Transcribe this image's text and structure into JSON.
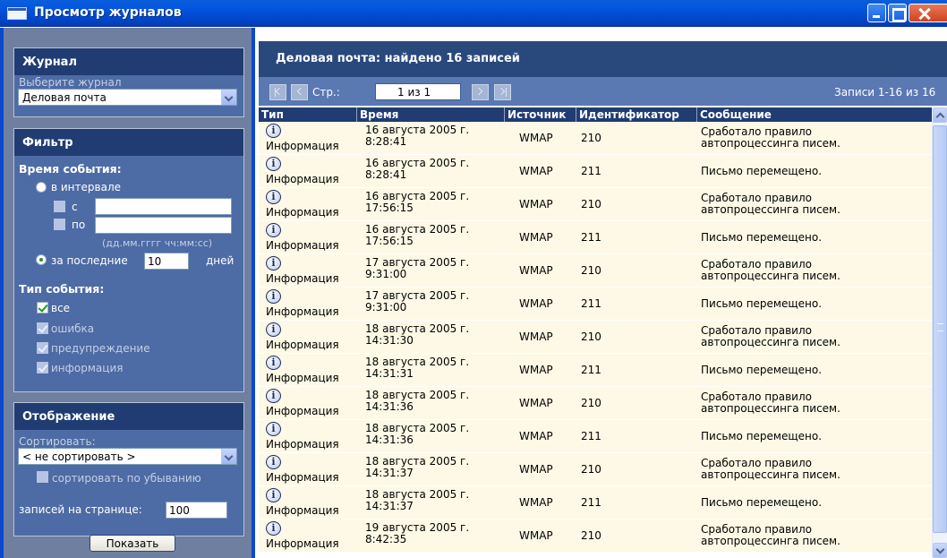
{
  "window": {
    "title": "Просмотр журналов"
  },
  "sidebar": {
    "journal": {
      "heading": "Журнал",
      "select_label": "Выберите журнал",
      "selected": "Деловая почта"
    },
    "filter": {
      "heading": "Фильтр",
      "event_time_label": "Время события:",
      "in_interval_label": "в интервале",
      "from_label": "с",
      "from_value": "",
      "to_label": "по",
      "to_value": "",
      "format_hint": "(дд.мм.гггг чч:мм:сс)",
      "last_label": "за последние",
      "last_value": "10",
      "days_label": "дней",
      "time_mode": "last",
      "event_type_label": "Тип события:",
      "types": [
        {
          "label": "все",
          "checked": true,
          "enabled": true
        },
        {
          "label": "ошибка",
          "checked": true,
          "enabled": false
        },
        {
          "label": "предупреждение",
          "checked": true,
          "enabled": false
        },
        {
          "label": "информация",
          "checked": true,
          "enabled": false
        }
      ]
    },
    "display": {
      "heading": "Отображение",
      "sort_label": "Сортировать:",
      "sort_value": "< не сортировать >",
      "desc_label": "сортировать по убыванию",
      "desc_checked": false,
      "per_page_label": "записей на странице:",
      "per_page_value": "100"
    },
    "show_button": "Показать"
  },
  "main": {
    "heading": "Деловая почта: найдено 16 записей",
    "pager": {
      "page_label": "Стр.:",
      "page_value": "1 из 1",
      "records_info": "Записи 1-16 из 16"
    },
    "columns": [
      "Тип",
      "Время",
      "Источник",
      "Идентификатор",
      "Сообщение"
    ],
    "rows": [
      {
        "type": "Информация",
        "time1": "16 августа 2005 г.",
        "time2": "8:28:41",
        "source": "WMAP",
        "id": "210",
        "msg1": "Сработало правило",
        "msg2": "автопроцессинга писем."
      },
      {
        "type": "Информация",
        "time1": "16 августа 2005 г.",
        "time2": "8:28:41",
        "source": "WMAP",
        "id": "211",
        "msg1": "Письмо перемещено.",
        "msg2": ""
      },
      {
        "type": "Информация",
        "time1": "16 августа 2005 г.",
        "time2": "17:56:15",
        "source": "WMAP",
        "id": "210",
        "msg1": "Сработало правило",
        "msg2": "автопроцессинга писем."
      },
      {
        "type": "Информация",
        "time1": "16 августа 2005 г.",
        "time2": "17:56:15",
        "source": "WMAP",
        "id": "211",
        "msg1": "Письмо перемещено.",
        "msg2": ""
      },
      {
        "type": "Информация",
        "time1": "17 августа 2005 г.",
        "time2": "9:31:00",
        "source": "WMAP",
        "id": "210",
        "msg1": "Сработало правило",
        "msg2": "автопроцессинга писем."
      },
      {
        "type": "Информация",
        "time1": "17 августа 2005 г.",
        "time2": "9:31:00",
        "source": "WMAP",
        "id": "211",
        "msg1": "Письмо перемещено.",
        "msg2": ""
      },
      {
        "type": "Информация",
        "time1": "18 августа 2005 г.",
        "time2": "14:31:30",
        "source": "WMAP",
        "id": "210",
        "msg1": "Сработало правило",
        "msg2": "автопроцессинга писем."
      },
      {
        "type": "Информация",
        "time1": "18 августа 2005 г.",
        "time2": "14:31:31",
        "source": "WMAP",
        "id": "211",
        "msg1": "Письмо перемещено.",
        "msg2": ""
      },
      {
        "type": "Информация",
        "time1": "18 августа 2005 г.",
        "time2": "14:31:36",
        "source": "WMAP",
        "id": "210",
        "msg1": "Сработало правило",
        "msg2": "автопроцессинга писем."
      },
      {
        "type": "Информация",
        "time1": "18 августа 2005 г.",
        "time2": "14:31:36",
        "source": "WMAP",
        "id": "211",
        "msg1": "Письмо перемещено.",
        "msg2": ""
      },
      {
        "type": "Информация",
        "time1": "18 августа 2005 г.",
        "time2": "14:31:37",
        "source": "WMAP",
        "id": "210",
        "msg1": "Сработало правило",
        "msg2": "автопроцессинга писем."
      },
      {
        "type": "Информация",
        "time1": "18 августа 2005 г.",
        "time2": "14:31:37",
        "source": "WMAP",
        "id": "211",
        "msg1": "Письмо перемещено.",
        "msg2": ""
      },
      {
        "type": "Информация",
        "time1": "19 августа 2005 г.",
        "time2": "8:42:35",
        "source": "WMAP",
        "id": "210",
        "msg1": "Сработало правило",
        "msg2": "автопроцессинга писем."
      }
    ]
  },
  "colors": {
    "titlebar": "#0456e0",
    "sidebar_panel": "#4d6ba4",
    "panel_header": "#203c72",
    "row_background": "#fdf9e6"
  }
}
